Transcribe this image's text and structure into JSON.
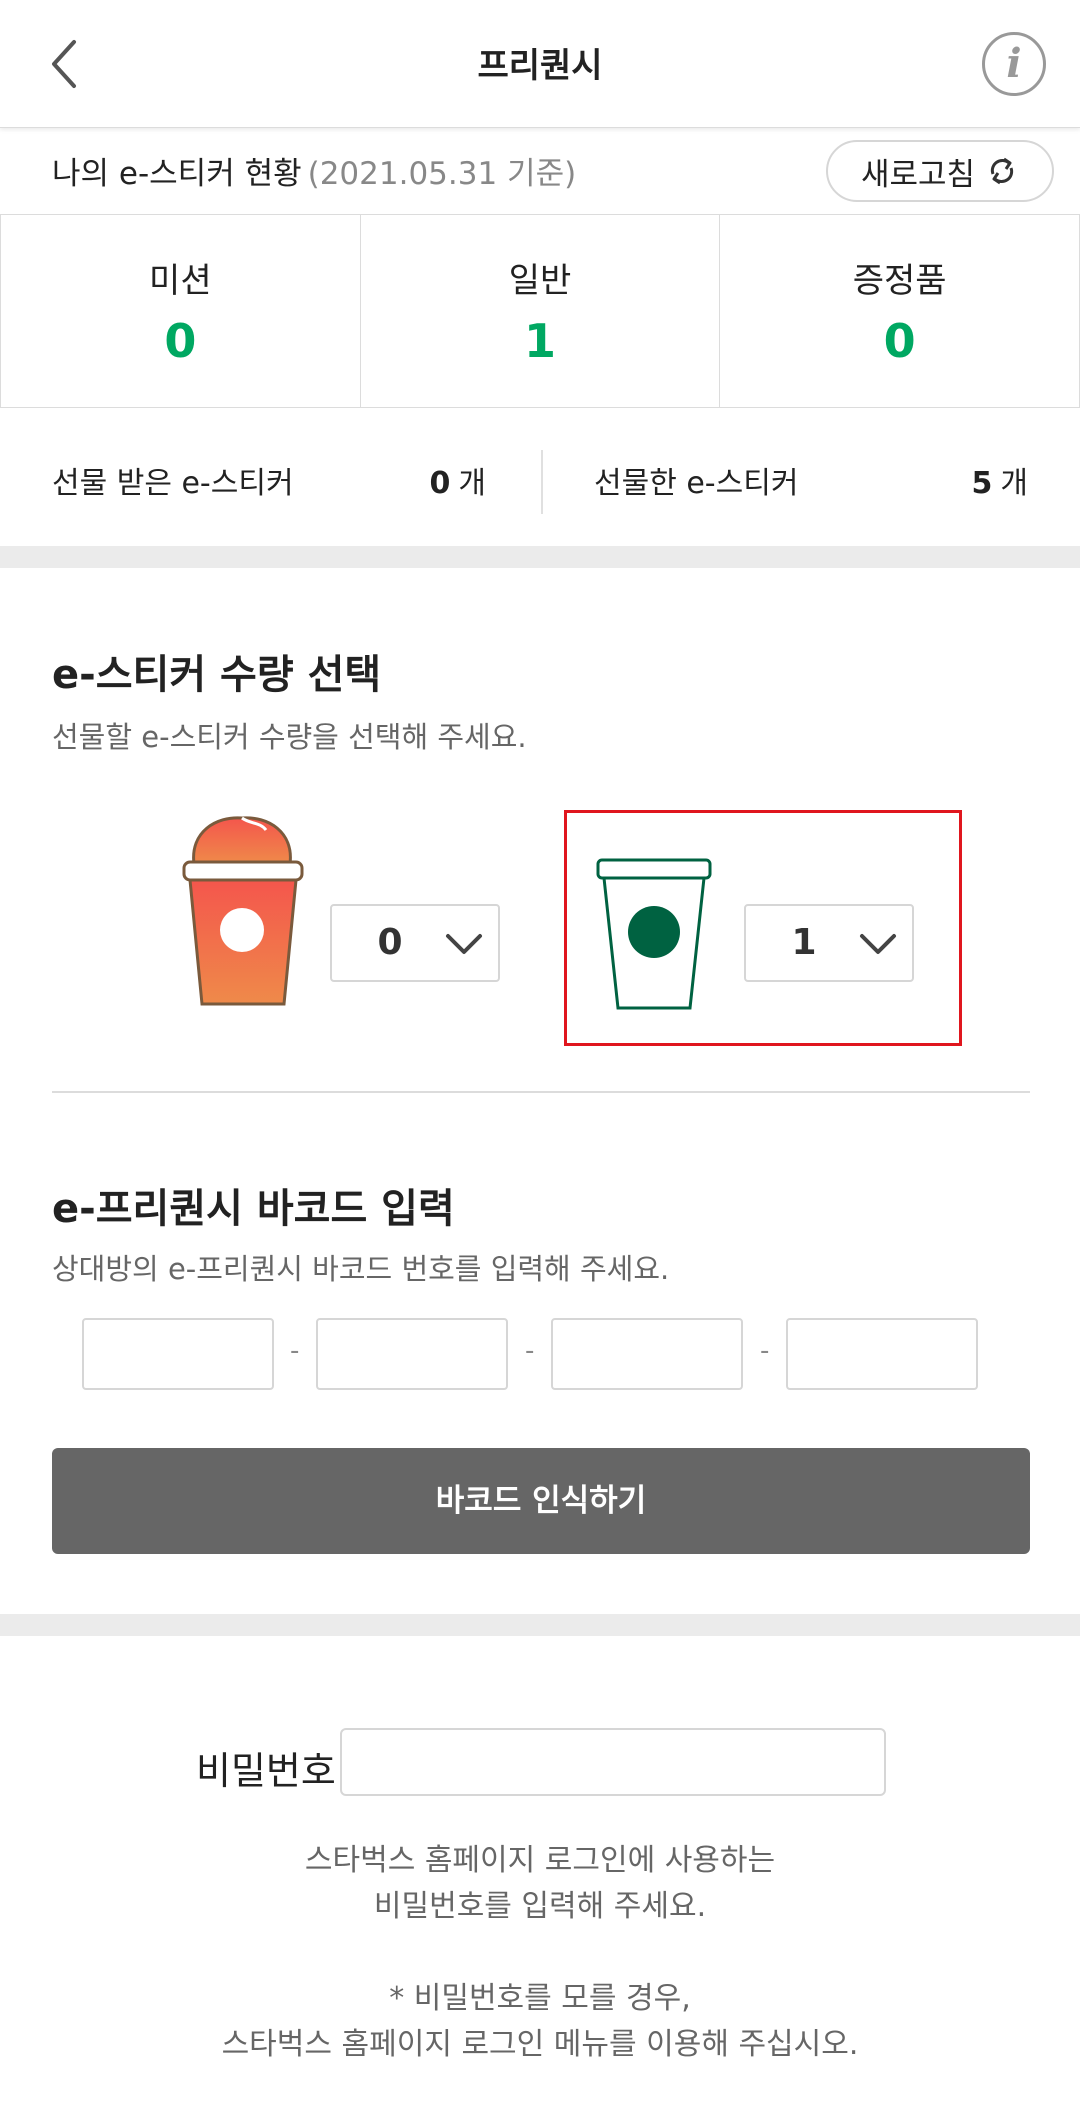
{
  "header": {
    "title": "프리퀀시",
    "back_icon": "chevron-left-icon",
    "info_icon": "info-icon",
    "info_glyph": "i"
  },
  "status": {
    "title": "나의 e-스티커 현황",
    "date": "(2021.05.31 기준)",
    "refresh_label": "새로고침",
    "refresh_icon": "refresh-icon"
  },
  "counts": [
    {
      "label": "미션",
      "value": "0"
    },
    {
      "label": "일반",
      "value": "1"
    },
    {
      "label": "증정품",
      "value": "0"
    }
  ],
  "gifts": {
    "received": {
      "label": "선물 받은 e-스티커",
      "value": "0",
      "unit": "개"
    },
    "sent": {
      "label": "선물한 e-스티커",
      "value": "5",
      "unit": "개"
    }
  },
  "quantity": {
    "title": "e-스티커 수량 선택",
    "description": "선물할 e-스티커 수량을 선택해 주세요.",
    "items": [
      {
        "type": "mission-cup",
        "selected": "0"
      },
      {
        "type": "regular-cup",
        "selected": "1"
      }
    ],
    "highlight_color": "#e0161e"
  },
  "barcode": {
    "title": "e-프리퀀시 바코드 입력",
    "description": "상대방의 e-프리퀀시 바코드 번호를 입력해 주세요.",
    "fields": [
      "",
      "",
      "",
      ""
    ],
    "separator": "-",
    "scan_label": "바코드 인식하기"
  },
  "password": {
    "label": "비밀번호",
    "value": "",
    "help_line1": "스타벅스 홈페이지 로그인에 사용하는",
    "help_line2": "비밀번호를 입력해 주세요.",
    "note_line1": "* 비밀번호를 모를 경우,",
    "note_line2": "스타벅스 홈페이지 로그인 메뉴를 이용해 주십시오."
  },
  "colors": {
    "accent": "#00a862",
    "button": "#666666",
    "highlight": "#e0161e",
    "cup_green": "#006241"
  }
}
